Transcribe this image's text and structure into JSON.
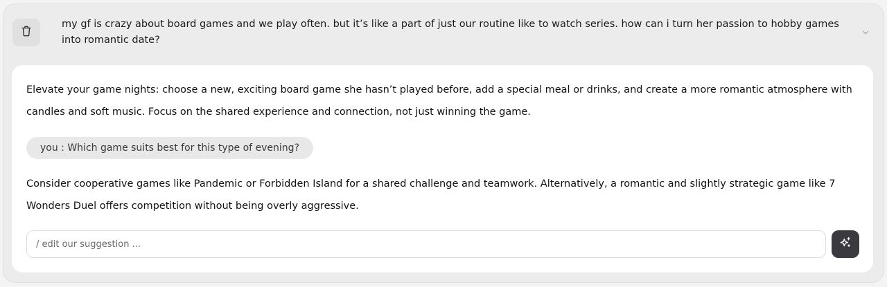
{
  "conversation": {
    "question": "my gf is crazy about board games and we play often. but it’s like a part of just our routine like to watch series. how can i turn her passion to hobby games into romantic date?",
    "answer_1": "Elevate your game nights: choose a new, exciting board game she hasn’t played before, add a special meal or drinks, and create a more romantic atmosphere with candles and soft music. Focus on the shared experience and connection, not just winning the game.",
    "followup": "you : Which game suits best for this type of evening?",
    "answer_2": "Consider cooperative games like Pandemic or Forbidden Island for a shared challenge and teamwork. Alternatively, a romantic and slightly strategic game like 7 Wonders Duel offers competition without being overly aggressive."
  },
  "composer": {
    "placeholder": "/ edit our suggestion ..."
  },
  "icons": {
    "delete": "trash-icon",
    "expand": "chevron-down-icon",
    "generate": "sparkle-icon"
  },
  "colors": {
    "card_background": "#ececec",
    "panel_background": "#ffffff",
    "followup_chip": "#e8e8e8",
    "action_button": "#3a3a3f"
  }
}
